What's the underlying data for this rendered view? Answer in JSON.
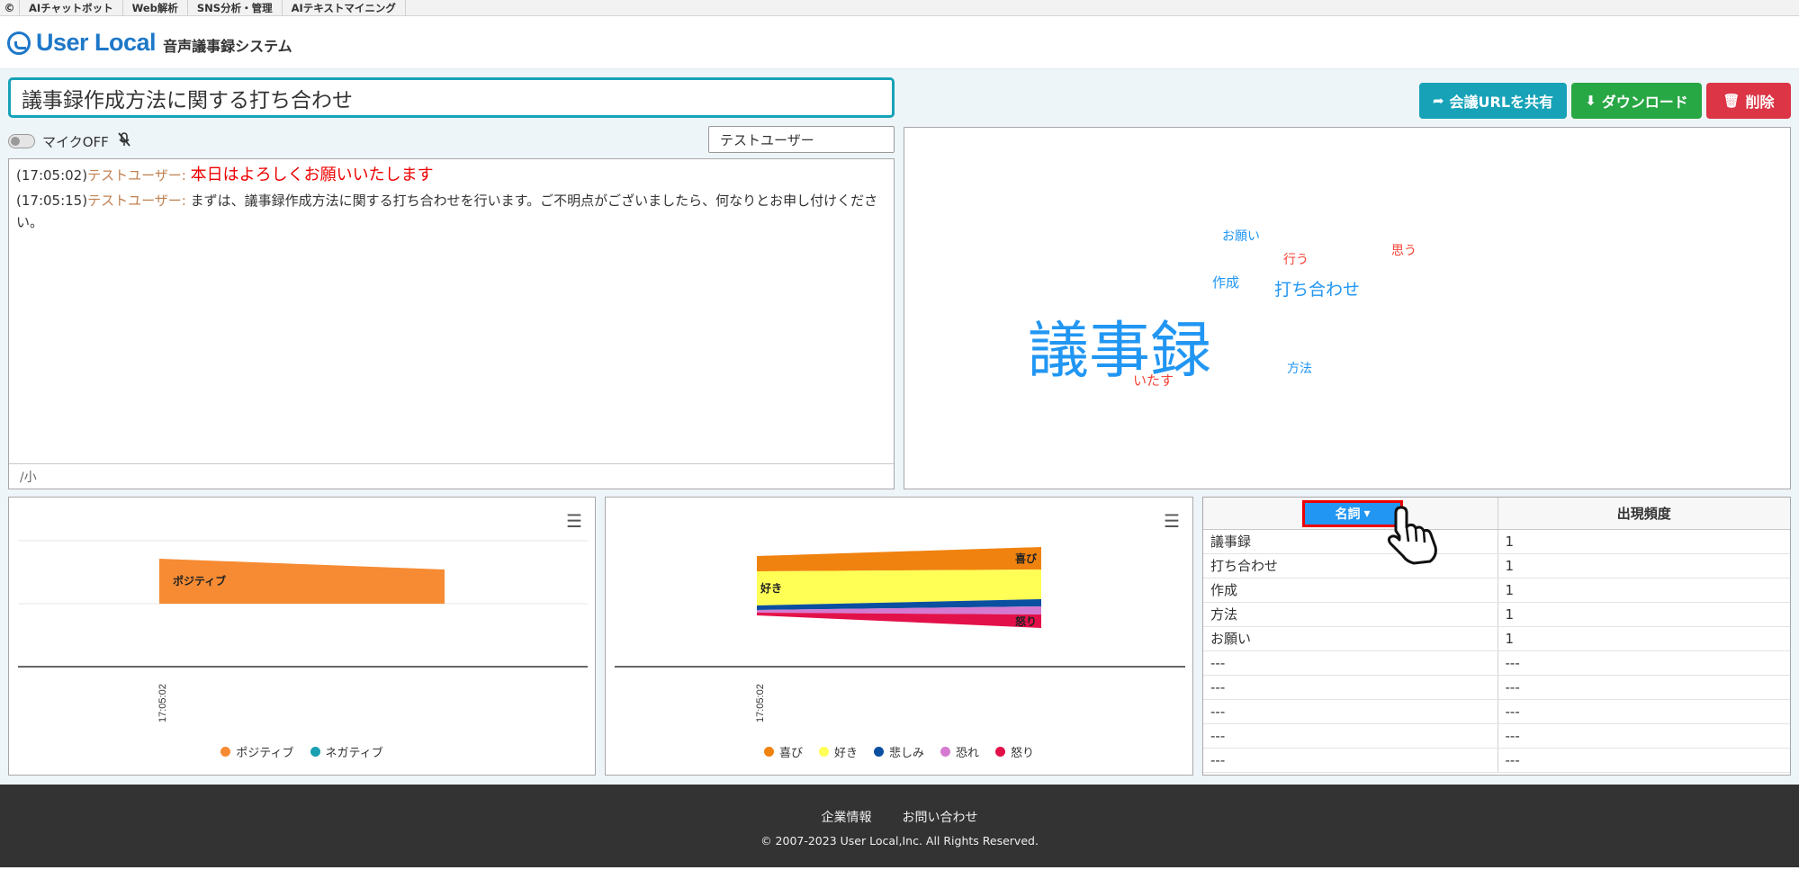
{
  "topbar": {
    "logo": "©",
    "items": [
      "AIチャットボット",
      "Web解析",
      "SNS分析・管理",
      "AIテキストマイニング"
    ]
  },
  "header": {
    "logo_text": "User Local",
    "system_name": "音声議事録システム"
  },
  "meeting": {
    "title": "議事録作成方法に関する打ち合わせ"
  },
  "buttons": {
    "share": "会議URLを共有",
    "download": "ダウンロード",
    "delete": "削除"
  },
  "mic": {
    "label": "マイクOFF"
  },
  "speaker": {
    "selected": "テストユーザー"
  },
  "transcript": {
    "lines": [
      {
        "time": "(17:05:02)",
        "speaker": "テストユーザー:",
        "text": "本日はよろしくお願いいたします"
      },
      {
        "time": "(17:05:15)",
        "speaker": "テストユーザー:",
        "text": "まずは、議事録作成方法に関する打ち合わせを行います。ご不明点がございましたら、何なりとお申し付けください。"
      }
    ],
    "footer": "/小"
  },
  "wordcloud": {
    "words": [
      {
        "text": "議事録",
        "color": "#2196f3"
      },
      {
        "text": "打ち合わせ",
        "color": "#2196f3"
      },
      {
        "text": "作成",
        "color": "#2196f3"
      },
      {
        "text": "方法",
        "color": "#2196f3"
      },
      {
        "text": "お願い",
        "color": "#2196f3"
      },
      {
        "text": "行う",
        "color": "#f44336"
      },
      {
        "text": "思う",
        "color": "#f44336"
      },
      {
        "text": "いたす",
        "color": "#f44336"
      }
    ]
  },
  "chart_data": [
    {
      "type": "area",
      "x": [
        "17:05:02"
      ],
      "series": [
        {
          "name": "ポジティブ",
          "color": "#f68b33"
        },
        {
          "name": "ネガティブ",
          "color": "#1aa0b0"
        }
      ],
      "labels_on_chart": [
        "ポジティブ"
      ],
      "legend": "bottom"
    },
    {
      "type": "area",
      "x": [
        "17:05:02"
      ],
      "series": [
        {
          "name": "喜び",
          "color": "#f0820f"
        },
        {
          "name": "好き",
          "color": "#ffff55"
        },
        {
          "name": "悲しみ",
          "color": "#0b4fa0"
        },
        {
          "name": "恐れ",
          "color": "#d57ad0"
        },
        {
          "name": "怒り",
          "color": "#e3114a"
        }
      ],
      "labels_on_chart": [
        "喜び",
        "好き",
        "怒り"
      ],
      "legend": "bottom"
    }
  ],
  "freq_table": {
    "col1_label": "名詞",
    "col2_label": "出現頻度",
    "rows": [
      {
        "word": "議事録",
        "count": "1"
      },
      {
        "word": "打ち合わせ",
        "count": "1"
      },
      {
        "word": "作成",
        "count": "1"
      },
      {
        "word": "方法",
        "count": "1"
      },
      {
        "word": "お願い",
        "count": "1"
      },
      {
        "word": "---",
        "count": "---"
      },
      {
        "word": "---",
        "count": "---"
      },
      {
        "word": "---",
        "count": "---"
      },
      {
        "word": "---",
        "count": "---"
      },
      {
        "word": "---",
        "count": "---"
      }
    ]
  },
  "footer": {
    "links": [
      "企業情報",
      "お問い合わせ"
    ],
    "copyright": "© 2007-2023 User Local,Inc. All Rights Reserved."
  }
}
